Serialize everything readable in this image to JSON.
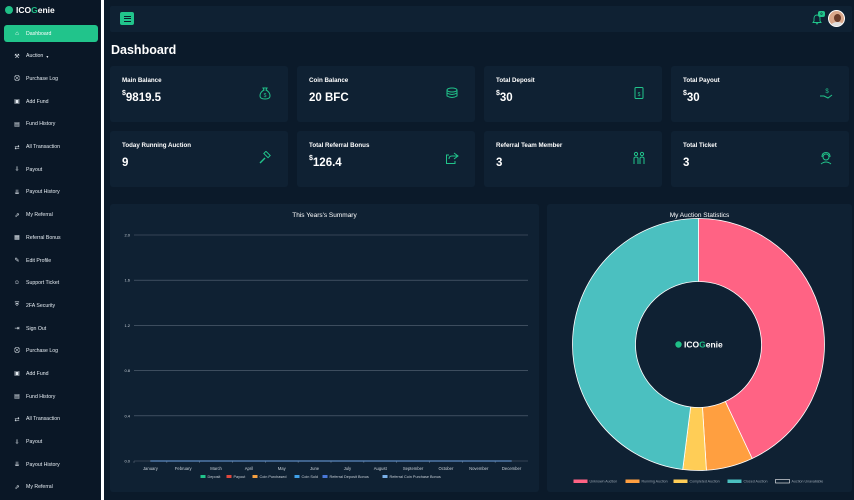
{
  "brand": {
    "name_prefix": "ICO",
    "name_accent": "G",
    "name_suffix": "enie"
  },
  "sidebar": {
    "items": [
      {
        "label": "Dashboard",
        "icon": "home-icon",
        "active": true
      },
      {
        "label": "Auction",
        "icon": "gavel-icon",
        "caret": "▾"
      },
      {
        "label": "Purchase Log",
        "icon": "cart-icon"
      },
      {
        "label": "Add Fund",
        "icon": "wallet-icon"
      },
      {
        "label": "Fund History",
        "icon": "history-icon"
      },
      {
        "label": "All Transaction",
        "icon": "exchange-icon"
      },
      {
        "label": "Payout",
        "icon": "payout-icon"
      },
      {
        "label": "Payout History",
        "icon": "payout-history-icon"
      },
      {
        "label": "My Referral",
        "icon": "share-icon"
      },
      {
        "label": "Referral Bonus",
        "icon": "gift-icon"
      },
      {
        "label": "Edit Profile",
        "icon": "user-edit-icon"
      },
      {
        "label": "Support Ticket",
        "icon": "ticket-icon"
      },
      {
        "label": "2FA Security",
        "icon": "shield-icon"
      },
      {
        "label": "Sign Out",
        "icon": "logout-icon"
      },
      {
        "label": "Purchase Log",
        "icon": "cart-icon"
      },
      {
        "label": "Add Fund",
        "icon": "wallet-icon"
      },
      {
        "label": "Fund History",
        "icon": "history-icon"
      },
      {
        "label": "All Transaction",
        "icon": "exchange-icon"
      },
      {
        "label": "Payout",
        "icon": "payout-icon"
      },
      {
        "label": "Payout History",
        "icon": "payout-history-icon"
      },
      {
        "label": "My Referral",
        "icon": "share-icon"
      }
    ]
  },
  "topbar": {
    "notification_count": "0"
  },
  "page": {
    "title": "Dashboard"
  },
  "cards": [
    {
      "label": "Main Balance",
      "currency": "$",
      "value": "9819.5",
      "icon": "money-bag-icon"
    },
    {
      "label": "Coin Balance",
      "currency": "",
      "value": "20 BFC",
      "icon": "coins-icon"
    },
    {
      "label": "Total Deposit",
      "currency": "$",
      "value": "30",
      "icon": "deposit-receipt-icon"
    },
    {
      "label": "Total Payout",
      "currency": "$",
      "value": "30",
      "icon": "hand-money-icon"
    },
    {
      "label": "Today Running Auction",
      "currency": "",
      "value": "9",
      "icon": "gavel-icon"
    },
    {
      "label": "Total Referral Bonus",
      "currency": "$",
      "value": "126.4",
      "icon": "share-out-icon"
    },
    {
      "label": "Referral Team Member",
      "currency": "",
      "value": "3",
      "icon": "team-icon"
    },
    {
      "label": "Total Ticket",
      "currency": "",
      "value": "3",
      "icon": "support-agent-icon"
    }
  ],
  "colors": {
    "accent": "#21c48b",
    "background": "#0b1a2a",
    "panel": "#0f2133"
  },
  "chart_data": [
    {
      "type": "line",
      "title": "This Years's Summary",
      "categories": [
        "January",
        "February",
        "March",
        "April",
        "May",
        "June",
        "July",
        "August",
        "September",
        "October",
        "November",
        "December"
      ],
      "ylim": [
        0,
        2
      ],
      "yticks": [
        "0.0",
        "0.4",
        "0.8",
        "1.2",
        "1.6",
        "2.0"
      ],
      "grid": true,
      "legend_position": "bottom",
      "series": [
        {
          "name": "Deposit",
          "color": "#21c48b",
          "values": [
            0,
            0,
            0,
            0,
            0,
            0,
            0,
            0,
            0,
            0,
            0,
            0
          ]
        },
        {
          "name": "Payout",
          "color": "#e0483e",
          "values": [
            0,
            0,
            0,
            0,
            0,
            0,
            0,
            0,
            0,
            0,
            0,
            0
          ]
        },
        {
          "name": "Coin Purchased",
          "color": "#f5a040",
          "values": [
            0,
            0,
            0,
            0,
            0,
            0,
            0,
            0,
            0,
            0,
            0,
            0
          ]
        },
        {
          "name": "Coin Sold",
          "color": "#3fa0e8",
          "values": [
            0,
            0,
            0,
            0,
            0,
            0,
            0,
            0,
            0,
            0,
            0,
            0
          ]
        },
        {
          "name": "Referral Deposit Bonus",
          "color": "#4a78d8",
          "values": [
            0,
            0,
            0,
            0,
            0,
            0,
            0,
            0,
            0,
            0,
            0,
            0
          ]
        },
        {
          "name": "Referral Coin Purchase Bonus",
          "color": "#7ab0e8",
          "values": [
            0,
            0,
            0,
            0,
            0,
            0,
            0,
            0,
            0,
            0,
            0,
            0
          ]
        }
      ]
    },
    {
      "type": "pie",
      "title": "My Auction Statistics",
      "center_label_prefix": "ICO",
      "center_label_accent": "G",
      "center_label_suffix": "enie",
      "legend_position": "bottom",
      "slices": [
        {
          "name": "Unknown Auction",
          "value": 43,
          "color": "#ff6384"
        },
        {
          "name": "Running Auction",
          "value": 6,
          "color": "#ff9f40"
        },
        {
          "name": "Completed Auction",
          "value": 3,
          "color": "#ffcd56"
        },
        {
          "name": "Closed Auction",
          "value": 48,
          "color": "#4bc0c0"
        },
        {
          "name": "Auction Unavailable",
          "value": 0,
          "color": "#ffffff"
        }
      ]
    }
  ]
}
